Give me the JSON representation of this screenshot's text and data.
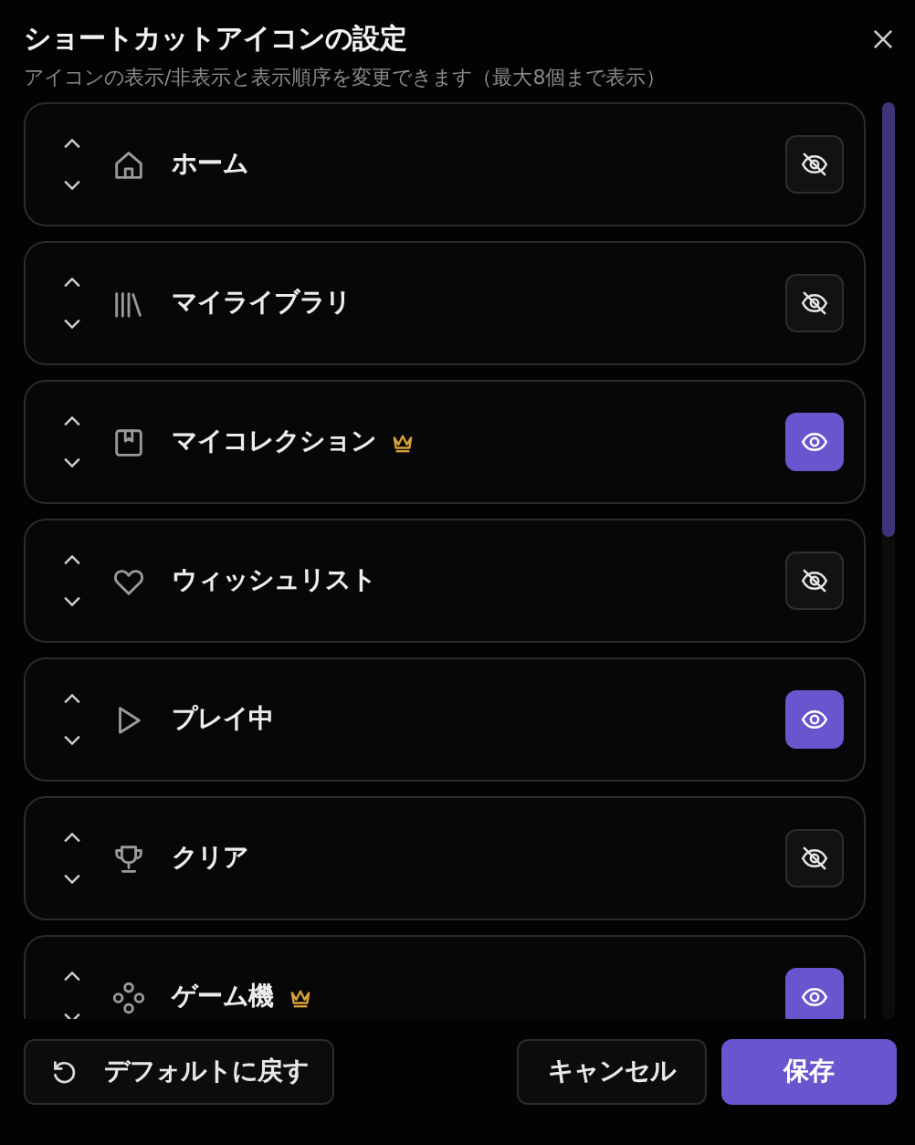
{
  "dialog": {
    "title": "ショートカットアイコンの設定",
    "subtitle": "アイコンの表示/非表示と表示順序を変更できます（最大8個まで表示）"
  },
  "items": [
    {
      "label": "ホーム",
      "premium": false,
      "visible": false
    },
    {
      "label": "マイライブラリ",
      "premium": false,
      "visible": false
    },
    {
      "label": "マイコレクション",
      "premium": true,
      "visible": true
    },
    {
      "label": "ウィッシュリスト",
      "premium": false,
      "visible": false
    },
    {
      "label": "プレイ中",
      "premium": false,
      "visible": true
    },
    {
      "label": "クリア",
      "premium": false,
      "visible": false
    },
    {
      "label": "ゲーム機",
      "premium": true,
      "visible": true
    }
  ],
  "footer": {
    "reset": "デフォルトに戻す",
    "cancel": "キャンセル",
    "save": "保存"
  }
}
